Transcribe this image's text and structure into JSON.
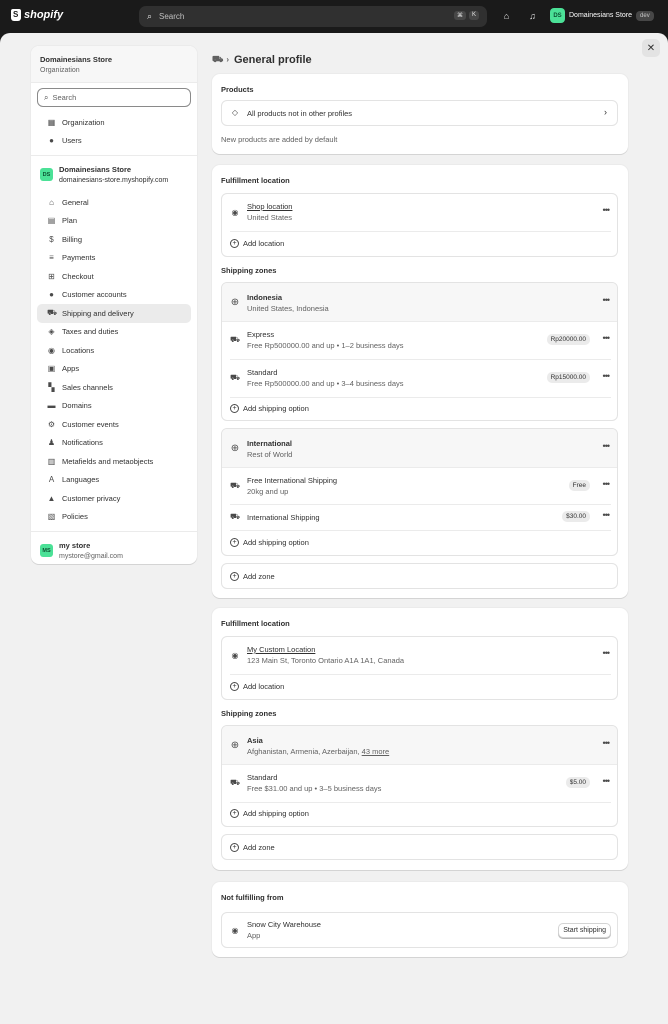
{
  "topbar": {
    "logo": "shopify",
    "search_placeholder": "Search",
    "shortcut_keys": [
      "⌘",
      "K"
    ],
    "store_initials": "DS",
    "store_name": "Domainesians Store",
    "env_badge": "dev"
  },
  "sidebar": {
    "org_title": "Domainesians Store",
    "org_subtitle": "Organization",
    "search_placeholder": "Search",
    "org_items": [
      {
        "label": "Organization",
        "icon": "building-icon"
      },
      {
        "label": "Users",
        "icon": "user-icon"
      }
    ],
    "store": {
      "initials": "DS",
      "name": "Domainesians Store",
      "domain": "domainesians-store.myshopify.com"
    },
    "items": [
      {
        "label": "General",
        "icon": "store-icon"
      },
      {
        "label": "Plan",
        "icon": "plan-icon"
      },
      {
        "label": "Billing",
        "icon": "billing-icon"
      },
      {
        "label": "Payments",
        "icon": "payments-icon"
      },
      {
        "label": "Checkout",
        "icon": "cart-icon"
      },
      {
        "label": "Customer accounts",
        "icon": "person-icon"
      },
      {
        "label": "Shipping and delivery",
        "icon": "truck-icon"
      },
      {
        "label": "Taxes and duties",
        "icon": "taxes-icon"
      },
      {
        "label": "Locations",
        "icon": "location-icon"
      },
      {
        "label": "Apps",
        "icon": "apps-icon"
      },
      {
        "label": "Sales channels",
        "icon": "channels-icon"
      },
      {
        "label": "Domains",
        "icon": "globe-icon"
      },
      {
        "label": "Customer events",
        "icon": "events-icon"
      },
      {
        "label": "Notifications",
        "icon": "bell-icon"
      },
      {
        "label": "Metafields and metaobjects",
        "icon": "metafields-icon"
      },
      {
        "label": "Languages",
        "icon": "language-icon"
      },
      {
        "label": "Customer privacy",
        "icon": "lock-icon"
      },
      {
        "label": "Policies",
        "icon": "policy-icon"
      }
    ],
    "active_index": 6,
    "user": {
      "initials": "MS",
      "name": "my store",
      "email": "mystore@gmail.com"
    }
  },
  "main": {
    "title": "General profile",
    "products": {
      "heading": "Products",
      "row_label": "All products not in other profiles",
      "note": "New products are added by default"
    },
    "profile1": {
      "location_heading": "Fulfillment location",
      "location_name": "Shop location",
      "location_address": "United States",
      "add_location": "Add location",
      "zones_heading": "Shipping zones",
      "zones": [
        {
          "name": "Indonesia",
          "countries": "United States, Indonesia",
          "rates": [
            {
              "name": "Express",
              "detail": "Free Rp500000.00 and up • 1–2 business days",
              "price": "Rp20000.00"
            },
            {
              "name": "Standard",
              "detail": "Free Rp500000.00 and up • 3–4 business days",
              "price": "Rp15000.00"
            }
          ],
          "add_option": "Add shipping option"
        },
        {
          "name": "International",
          "countries": "Rest of World",
          "rates": [
            {
              "name": "Free International Shipping",
              "detail": "20kg and up",
              "price": "Free"
            },
            {
              "name": "International Shipping",
              "detail": "",
              "price": "$30.00"
            }
          ],
          "add_option": "Add shipping option"
        }
      ],
      "add_zone": "Add zone"
    },
    "profile2": {
      "location_heading": "Fulfillment location",
      "location_name": "My Custom Location",
      "location_address": "123 Main St, Toronto Ontario A1A 1A1, Canada",
      "add_location": "Add location",
      "zones_heading": "Shipping zones",
      "zone": {
        "name": "Asia",
        "countries": "Afghanistan, Armenia, Azerbaijan,",
        "more": "43 more",
        "rate": {
          "name": "Standard",
          "detail": "Free $31.00 and up • 3–5 business days",
          "price": "$5.00"
        },
        "add_option": "Add shipping option"
      },
      "add_zone": "Add zone"
    },
    "not_fulfilling": {
      "heading": "Not fulfilling from",
      "name": "Snow City Warehouse",
      "type": "App",
      "button": "Start shipping"
    }
  }
}
